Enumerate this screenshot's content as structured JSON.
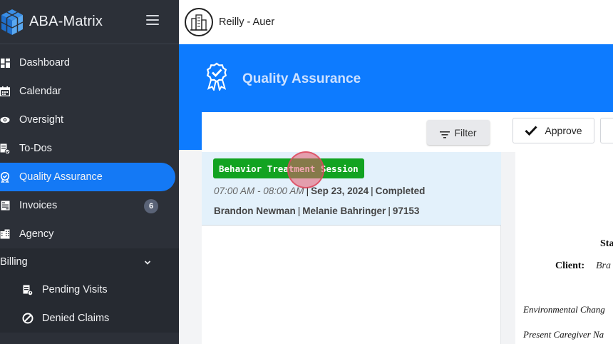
{
  "app": {
    "name": "ABA-Matrix"
  },
  "org": {
    "name": "Reilly - Auer"
  },
  "sidebar": {
    "items": [
      {
        "label": "Dashboard",
        "icon": "dashboard-icon"
      },
      {
        "label": "Calendar",
        "icon": "calendar-icon"
      },
      {
        "label": "Oversight",
        "icon": "eye-icon"
      },
      {
        "label": "To-Dos",
        "icon": "todo-icon"
      },
      {
        "label": "Quality Assurance",
        "icon": "badge-check-icon",
        "active": true
      },
      {
        "label": "Invoices",
        "icon": "invoice-icon",
        "badge": "6"
      },
      {
        "label": "Agency",
        "icon": "building-icon"
      }
    ],
    "billing": {
      "label": "Billing",
      "items": [
        {
          "label": "Pending Visits",
          "icon": "pending-icon"
        },
        {
          "label": "Denied Claims",
          "icon": "denied-icon"
        }
      ]
    }
  },
  "page": {
    "title": "Quality Assurance"
  },
  "toolbar": {
    "filter_label": "Filter",
    "approve_label": "Approve"
  },
  "session": {
    "tag": "Behavior Treatment Session",
    "time": "07:00 AM - 08:00 AM",
    "date": "Sep 23, 2024",
    "status": "Completed",
    "client": "Brandon Newman",
    "provider": "Melanie Bahringer",
    "code": "97153"
  },
  "document": {
    "status_label": "Sta",
    "client_label": "Client:",
    "client_value": "Bra",
    "env_label": "Environmental Chang",
    "caregiver_label": "Present Caregiver Na"
  },
  "colors": {
    "sidebar": "#2c3038",
    "accent": "#0d7bff",
    "tag": "#12a321",
    "row_selected": "#e3f1fb"
  }
}
